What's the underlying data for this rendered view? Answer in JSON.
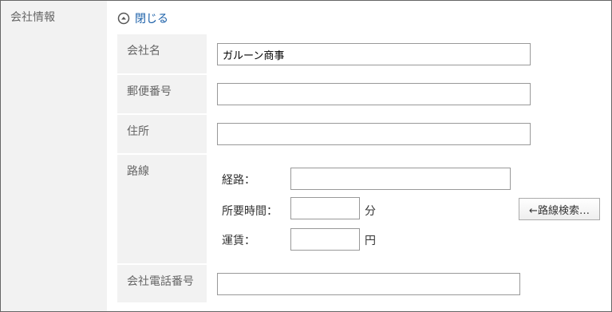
{
  "section": {
    "label": "会社情報"
  },
  "toggle": {
    "label": "閉じる",
    "icon": "collapse-up-circle-icon"
  },
  "fields": {
    "company_name": {
      "label": "会社名",
      "value": "ガルーン商事"
    },
    "postal_code": {
      "label": "郵便番号",
      "value": ""
    },
    "address": {
      "label": "住所",
      "value": ""
    },
    "route": {
      "label": "路線",
      "path_label": "経路：",
      "path_value": "",
      "time_label": "所要時間：",
      "time_value": "",
      "time_unit": "分",
      "fare_label": "運賃：",
      "fare_value": "",
      "fare_unit": "円",
      "search_button": "←路線検索…"
    },
    "phone": {
      "label": "会社電話番号",
      "value": ""
    }
  }
}
